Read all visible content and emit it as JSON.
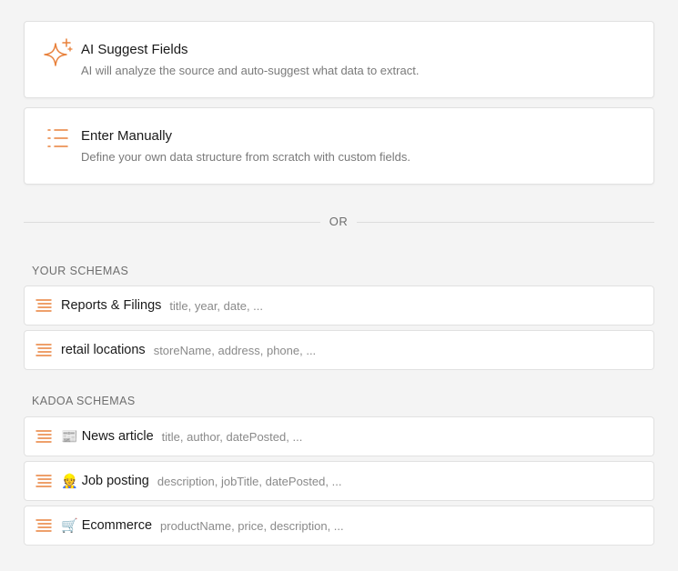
{
  "options": [
    {
      "title": "AI Suggest Fields",
      "description": "AI will analyze the source and auto-suggest what data to extract.",
      "icon": "sparkle-icon"
    },
    {
      "title": "Enter Manually",
      "description": "Define your own data structure from scratch with custom fields.",
      "icon": "list-icon"
    }
  ],
  "divider_label": "OR",
  "your_schemas": {
    "label": "YOUR SCHEMAS",
    "items": [
      {
        "name": "Reports & Filings",
        "fields": "title, year, date, ..."
      },
      {
        "name": "retail locations",
        "fields": "storeName, address, phone, ..."
      }
    ]
  },
  "kadoa_schemas": {
    "label": "KADOA SCHEMAS",
    "items": [
      {
        "emoji": "📰",
        "name": "News article",
        "fields": "title, author, datePosted, ..."
      },
      {
        "emoji": "👷",
        "name": "Job posting",
        "fields": "description, jobTitle, datePosted, ..."
      },
      {
        "emoji": "🛒",
        "name": "Ecommerce",
        "fields": "productName, price, description, ..."
      }
    ]
  },
  "colors": {
    "accent": "#e8803a",
    "border": "#e1e1e1",
    "muted_text": "#7a7a7a"
  },
  "icons": {
    "schema_row": "schema-stack-icon"
  }
}
